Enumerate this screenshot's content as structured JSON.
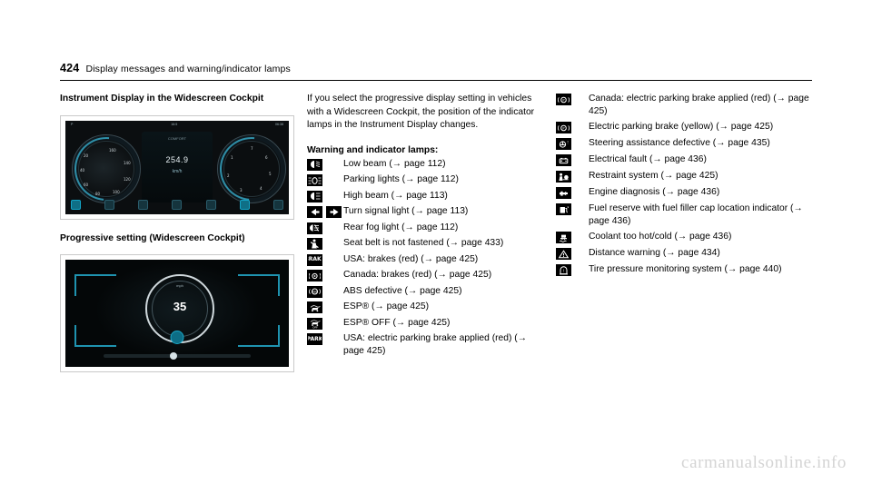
{
  "header": {
    "page_number": "424",
    "title": "Display messages and warning/indicator lamps"
  },
  "col1": {
    "section1_title": "Instrument Display in the Widescreen Cockpit",
    "figure1": {
      "status_left": "P",
      "status_center": "16:5",
      "status_right": "06:38",
      "speed_value": "254.9",
      "speed_unit": "km/h",
      "center_top": "COMFORT",
      "dial_left_numbers": [
        "20",
        "40",
        "60",
        "80",
        "100",
        "120",
        "140",
        "160"
      ],
      "dial_right_numbers": [
        "1",
        "2",
        "3",
        "4",
        "5",
        "6",
        "7"
      ]
    },
    "section2_title": "Progressive setting (Widescreen Cockpit)",
    "figure2": {
      "speed_value": "35",
      "unit": "mph"
    }
  },
  "col2": {
    "intro": "If you select the progressive display setting in vehicles with a Widescreen Cockpit, the position of the indicator lamps in the Instrument Display changes.",
    "legend_heading": "Warning and indicator lamps:",
    "items": [
      {
        "icons": [
          "low-beam-icon"
        ],
        "text": "Low beam (→ page 112)"
      },
      {
        "icons": [
          "parking-lights-icon"
        ],
        "text": "Parking lights (→ page 112)"
      },
      {
        "icons": [
          "high-beam-icon"
        ],
        "text": "High beam (→ page 113)"
      },
      {
        "icons": [
          "turn-signal-left-icon",
          "turn-signal-right-icon"
        ],
        "text": "Turn signal light (→ page 113)"
      },
      {
        "icons": [
          "rear-fog-light-icon"
        ],
        "text": "Rear fog light (→ page 112)"
      },
      {
        "icons": [
          "seat-belt-icon"
        ],
        "text": "Seat belt is not fastened (→ page 433)"
      },
      {
        "icons": [
          "brake-usa-icon"
        ],
        "text": "USA: brakes (red) (→ page 425)"
      },
      {
        "icons": [
          "brake-canada-icon"
        ],
        "text": "Canada: brakes (red) (→ page 425)"
      },
      {
        "icons": [
          "abs-icon"
        ],
        "text": "ABS defective (→ page 425)"
      },
      {
        "icons": [
          "esp-icon"
        ],
        "text": "ESP® (→ page 425)"
      },
      {
        "icons": [
          "esp-off-icon"
        ],
        "text": "ESP® OFF (→ page 425)"
      },
      {
        "icons": [
          "park-icon"
        ],
        "text": "USA: electric parking brake applied (red) (→ page 425)"
      }
    ]
  },
  "col3": {
    "items": [
      {
        "icons": [
          "parking-brake-canada-icon"
        ],
        "text": "Canada: electric parking brake applied (red) (→ page 425)"
      },
      {
        "icons": [
          "parking-brake-yellow-icon"
        ],
        "text": "Electric parking brake (yellow) (→ page 425)"
      },
      {
        "icons": [
          "steering-assist-icon"
        ],
        "text": "Steering assistance defective (→ page 435)"
      },
      {
        "icons": [
          "electrical-fault-icon"
        ],
        "text": "Electrical fault (→ page 436)"
      },
      {
        "icons": [
          "restraint-system-icon"
        ],
        "text": "Restraint system (→ page 425)"
      },
      {
        "icons": [
          "engine-diagnosis-icon"
        ],
        "text": "Engine diagnosis (→ page 436)"
      },
      {
        "icons": [
          "fuel-reserve-icon"
        ],
        "text": "Fuel reserve with fuel filler cap location indicator (→ page 436)"
      },
      {
        "icons": [
          "coolant-temp-icon"
        ],
        "text": "Coolant too hot/cold (→ page 436)"
      },
      {
        "icons": [
          "distance-warning-icon"
        ],
        "text": "Distance warning (→ page 434)"
      },
      {
        "icons": [
          "tire-pressure-icon"
        ],
        "text": "Tire pressure monitoring system (→ page 440)"
      }
    ]
  },
  "watermark": "carmanualsonline.info"
}
